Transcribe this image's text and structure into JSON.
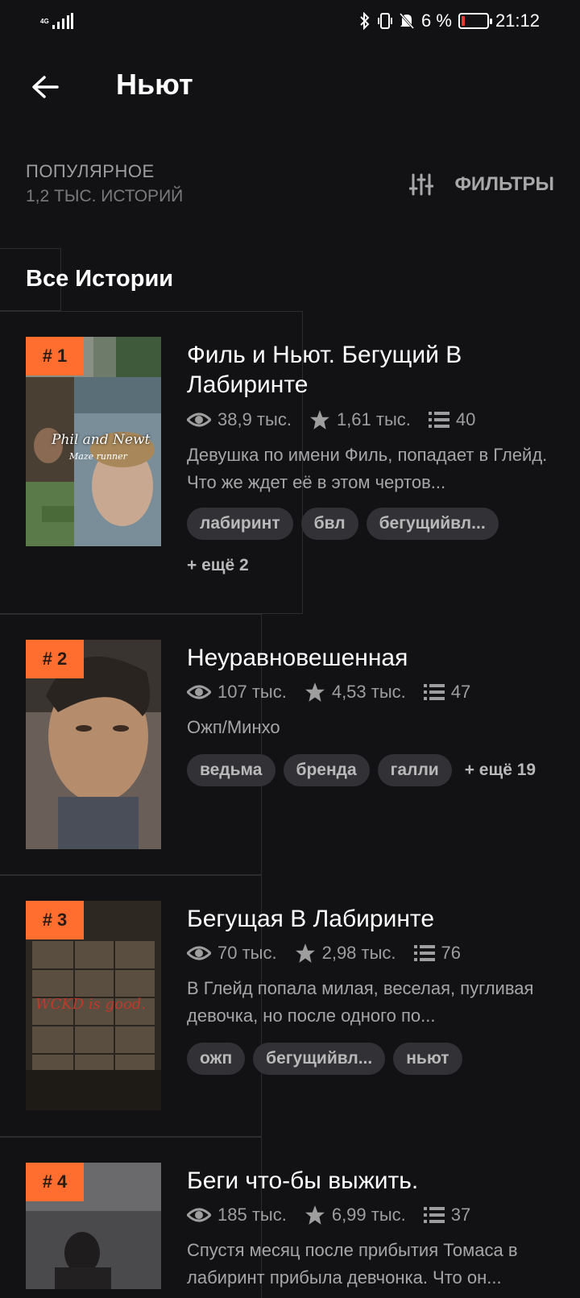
{
  "status_bar": {
    "network": "4G",
    "battery_percent": "6 %",
    "time": "21:12"
  },
  "header": {
    "title": "Ньют"
  },
  "section": {
    "label": "ПОПУЛЯРНОЕ",
    "count": "1,2 ТЫС. ИСТОРИЙ",
    "filters_label": "ФИЛЬТРЫ"
  },
  "tabs": {
    "all_stories": "Все Истории"
  },
  "stories": [
    {
      "rank": "# 1",
      "title": "Филь и Ньют. Бегущий В Лабиринте",
      "reads": "38,9 тыс.",
      "votes": "1,61 тыс.",
      "parts": "40",
      "description": "Девушка по имени Филь, попадает в Глейд. Что же ждет её в этом чертов...",
      "tags": [
        "лабиринт",
        "бвл",
        "бегущийвл..."
      ],
      "more_tags": "+ ещё 2",
      "cover_text": "Phil and Newt",
      "cover_subtext": "Maze runner"
    },
    {
      "rank": "# 2",
      "title": "Неуравновешенная",
      "reads": "107 тыс.",
      "votes": "4,53 тыс.",
      "parts": "47",
      "description": "Ожп/Минхо",
      "tags": [
        "ведьма",
        "бренда",
        "галли"
      ],
      "more_tags": "+ ещё 19"
    },
    {
      "rank": "# 3",
      "title": "Бегущая В Лабиринте",
      "reads": "70 тыс.",
      "votes": "2,98 тыс.",
      "parts": "76",
      "description": "В Глейд попала милая, веселая, пугливая девочка, но после одного по...",
      "tags": [
        "ожп",
        "бегущийвл...",
        "ньют"
      ],
      "cover_text": "WCKD is good."
    },
    {
      "rank": "# 4",
      "title": "Беги что-бы выжить.",
      "reads": "185 тыс.",
      "votes": "6,99 тыс.",
      "parts": "37",
      "description": "Спустя месяц после прибытия Томаса в лабиринт прибыла девчонка. Что он..."
    }
  ],
  "colors": {
    "background": "#121114",
    "accent": "#ff6e2e",
    "tag_bg": "#323236"
  }
}
